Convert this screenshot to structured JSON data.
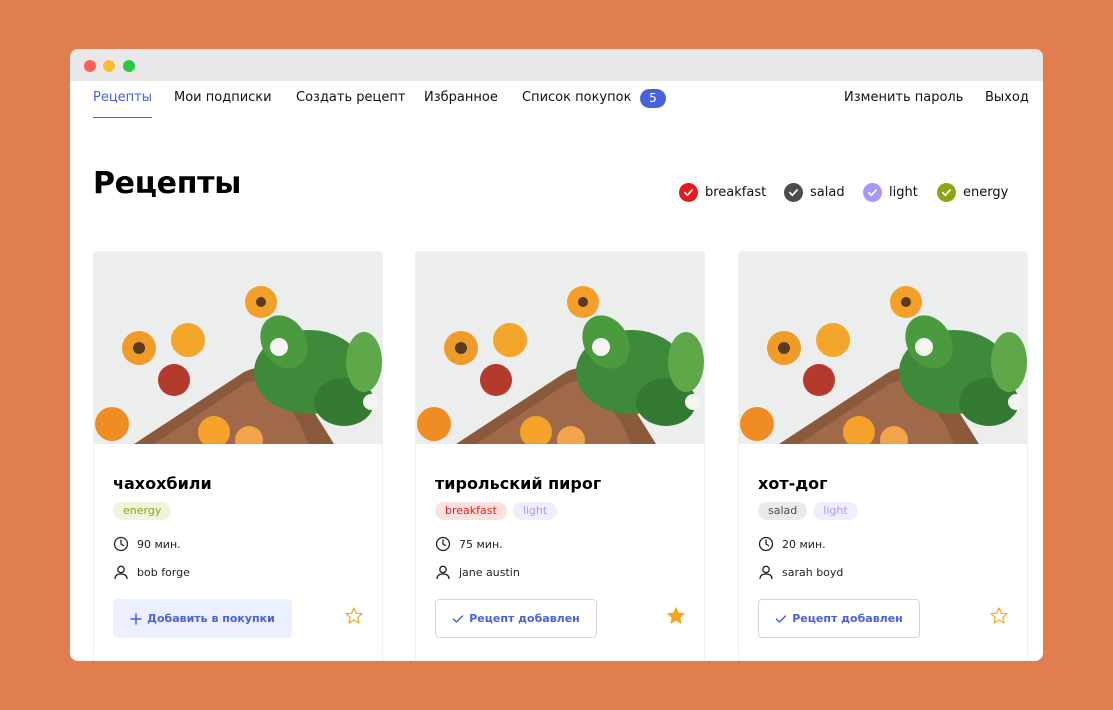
{
  "nav": {
    "items": [
      {
        "label": "Рецепты",
        "active": true
      },
      {
        "label": "Мои подписки"
      },
      {
        "label": "Создать рецепт"
      },
      {
        "label": "Избранное"
      },
      {
        "label": "Список покупок"
      }
    ],
    "cart_count": "5",
    "change_password": "Изменить пароль",
    "logout": "Выход"
  },
  "page_title": "Рецепты",
  "filters": [
    {
      "label": "breakfast",
      "color": "#E51B1B"
    },
    {
      "label": "salad",
      "color": "#4D4D4D"
    },
    {
      "label": "light",
      "color": "#A59BF5"
    },
    {
      "label": "energy",
      "color": "#8EA415"
    }
  ],
  "recipes": [
    {
      "title": "чахохбили",
      "tags": [
        {
          "label": "energy",
          "bg": "#EEF5DB",
          "fg": "#8EA415"
        }
      ],
      "time": "90 мин.",
      "author": "bob forge",
      "button": "Добавить в покупки",
      "button_icon": "plus-icon",
      "favorite": false
    },
    {
      "title": "тирольский пирог",
      "tags": [
        {
          "label": "breakfast",
          "bg": "#FCE1E1",
          "fg": "#E51B1B"
        },
        {
          "label": "light",
          "bg": "#F0EEFD",
          "fg": "#A59BF5"
        }
      ],
      "time": "75 мин.",
      "author": "jane austin",
      "button": "Рецепт добавлен",
      "button_icon": "check-icon",
      "favorite": true
    },
    {
      "title": "хот-дог",
      "tags": [
        {
          "label": "salad",
          "bg": "#EAEAEA",
          "fg": "#4D4D4D"
        },
        {
          "label": "light",
          "bg": "#F0EEFD",
          "fg": "#A59BF5"
        }
      ],
      "time": "20 мин.",
      "author": "sarah boyd",
      "button": "Рецепт добавлен",
      "button_icon": "check-icon",
      "favorite": false
    }
  ],
  "colors": {
    "accent": "#4A61DD",
    "star": "#F5A623",
    "background": "#E07E50"
  }
}
